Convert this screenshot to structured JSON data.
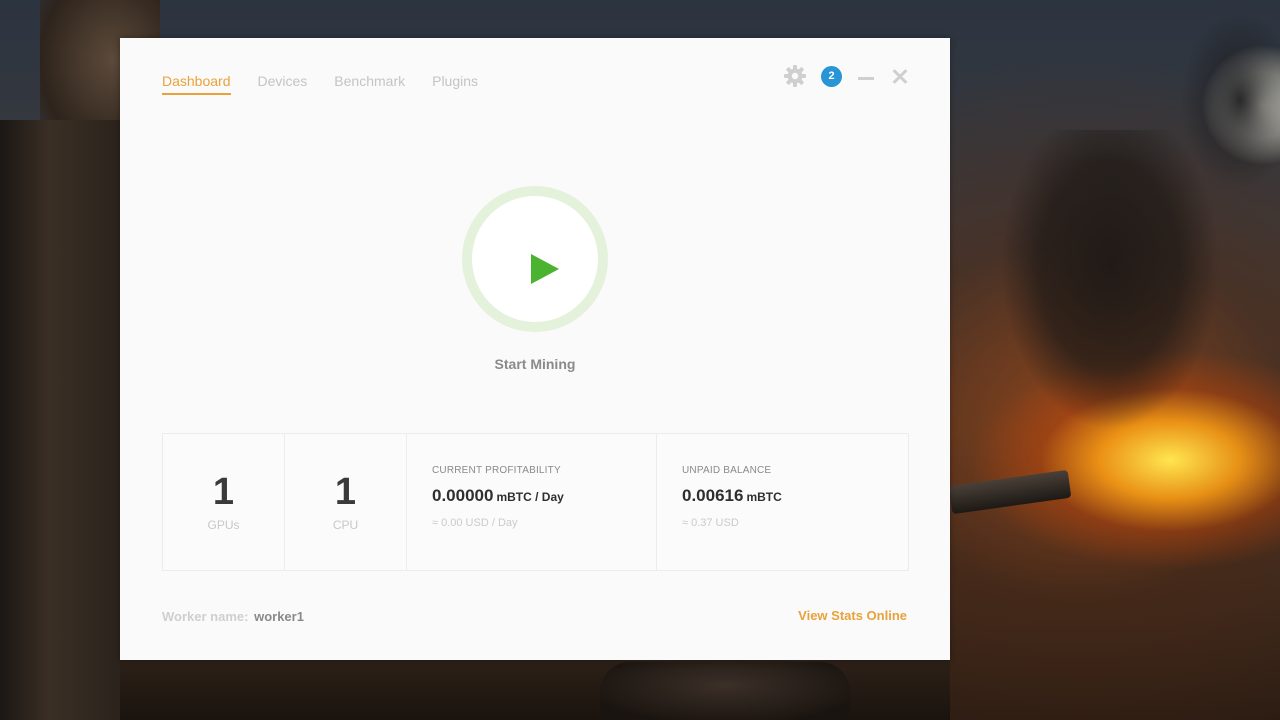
{
  "colors": {
    "accent": "#e9a23b",
    "badge": "#2795d6",
    "play_green": "#4ab32f",
    "ring_green": "#e4f2dc"
  },
  "tabs": [
    {
      "label": "Dashboard",
      "active": true
    },
    {
      "label": "Devices",
      "active": false
    },
    {
      "label": "Benchmark",
      "active": false
    },
    {
      "label": "Plugins",
      "active": false
    }
  ],
  "controls": {
    "settings_icon": "gear-icon",
    "notifications_count": "2",
    "minimize_icon": "minimize-icon",
    "close_icon": "close-icon"
  },
  "mining": {
    "button_icon": "play-icon",
    "label": "Start Mining"
  },
  "stats": {
    "gpus": {
      "value": "1",
      "label": "GPUs"
    },
    "cpu": {
      "value": "1",
      "label": "CPU"
    },
    "profitability": {
      "heading": "CURRENT PROFITABILITY",
      "value": "0.00000",
      "unit": "mBTC / Day",
      "fiat": "≈ 0.00 USD / Day"
    },
    "balance": {
      "heading": "UNPAID BALANCE",
      "value": "0.00616",
      "unit": "mBTC",
      "fiat": "≈ 0.37 USD"
    }
  },
  "footer": {
    "worker_label": "Worker name:",
    "worker_name": "worker1",
    "view_stats": "View Stats Online"
  }
}
